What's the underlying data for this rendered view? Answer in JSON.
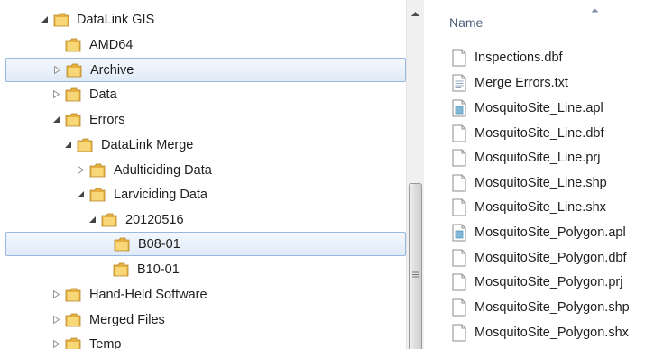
{
  "tree": {
    "items": [
      {
        "label": "DataLink GIS",
        "expander": "expanded",
        "selected": false
      },
      {
        "label": "AMD64",
        "expander": "none",
        "selected": false
      },
      {
        "label": "Archive",
        "expander": "collapsed",
        "selected": true
      },
      {
        "label": "Data",
        "expander": "collapsed",
        "selected": false
      },
      {
        "label": "Errors",
        "expander": "expanded",
        "selected": false
      },
      {
        "label": "DataLink Merge",
        "expander": "expanded",
        "selected": false
      },
      {
        "label": "Adulticiding Data",
        "expander": "collapsed",
        "selected": false
      },
      {
        "label": "Larviciding Data",
        "expander": "expanded",
        "selected": false
      },
      {
        "label": "20120516",
        "expander": "expanded",
        "selected": false
      },
      {
        "label": "B08-01",
        "expander": "none",
        "selected": true
      },
      {
        "label": "B10-01",
        "expander": "none",
        "selected": false
      },
      {
        "label": "Hand-Held Software",
        "expander": "collapsed",
        "selected": false
      },
      {
        "label": "Merged Files",
        "expander": "collapsed",
        "selected": false
      },
      {
        "label": "Temp",
        "expander": "collapsed",
        "selected": false
      }
    ]
  },
  "file_list": {
    "column_header": "Name",
    "sort": "ascending",
    "files": [
      {
        "name": "Inspections.dbf",
        "icon": "blank-file-icon"
      },
      {
        "name": "Merge Errors.txt",
        "icon": "text-file-icon"
      },
      {
        "name": "MosquitoSite_Line.apl",
        "icon": "apl-file-icon"
      },
      {
        "name": "MosquitoSite_Line.dbf",
        "icon": "blank-file-icon"
      },
      {
        "name": "MosquitoSite_Line.prj",
        "icon": "blank-file-icon"
      },
      {
        "name": "MosquitoSite_Line.shp",
        "icon": "blank-file-icon"
      },
      {
        "name": "MosquitoSite_Line.shx",
        "icon": "blank-file-icon"
      },
      {
        "name": "MosquitoSite_Polygon.apl",
        "icon": "apl-file-icon"
      },
      {
        "name": "MosquitoSite_Polygon.dbf",
        "icon": "blank-file-icon"
      },
      {
        "name": "MosquitoSite_Polygon.prj",
        "icon": "blank-file-icon"
      },
      {
        "name": "MosquitoSite_Polygon.shp",
        "icon": "blank-file-icon"
      },
      {
        "name": "MosquitoSite_Polygon.shx",
        "icon": "blank-file-icon"
      }
    ]
  },
  "colors": {
    "selection_fill": "#dfeaf8",
    "selection_border": "#99b8e0",
    "header_text": "#4c607a",
    "folder_yellow": "#f0c25a"
  }
}
